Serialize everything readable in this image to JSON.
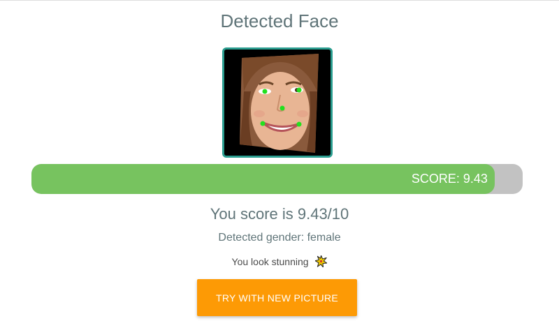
{
  "header": {
    "title": "Detected Face"
  },
  "face": {
    "icon": "face-photo-with-landmarks"
  },
  "score_bar": {
    "label": "SCORE: 9.43",
    "fill_fraction": 0.943,
    "fill_color": "#77c35f",
    "track_color": "#c2c2c2"
  },
  "result": {
    "score_text": "You score is 9.43/10",
    "gender_text": "Detected gender: female",
    "compliment_text": "You look stunning",
    "compliment_icon": "sparkle-icon"
  },
  "actions": {
    "try_button_label": "TRY WITH NEW PICTURE",
    "try_button_color": "#fd9a05"
  },
  "colors": {
    "frame_border": "#2a9d8f",
    "text": "#5f7478"
  }
}
